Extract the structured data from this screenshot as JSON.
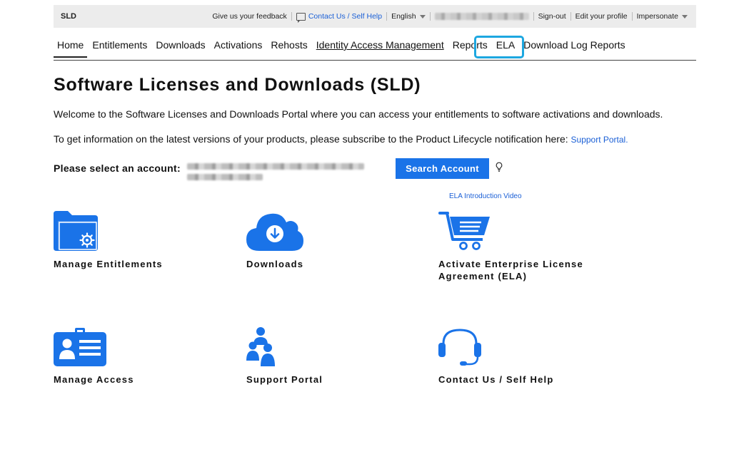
{
  "topbar": {
    "brand": "SLD",
    "feedback": "Give us your feedback",
    "contact": "Contact Us / Self Help",
    "language": "English",
    "signout": "Sign-out",
    "profile": "Edit your profile",
    "impersonate": "Impersonate"
  },
  "nav": {
    "items": [
      "Home",
      "Entitlements",
      "Downloads",
      "Activations",
      "Rehosts",
      "Identity Access Management",
      "Reports",
      "ELA",
      "Download Log Reports"
    ]
  },
  "main": {
    "title": "Software Licenses and Downloads (SLD)",
    "welcome": "Welcome to the Software Licenses and Downloads Portal where you can access your entitlements to software activations and downloads.",
    "subscribe_text": "To get information on the latest versions of your products, please subscribe to the Product Lifecycle notification here: ",
    "subscribe_link": "Support Portal.",
    "account_label": "Please select an account:",
    "search_button": "Search Account",
    "ela_video_link": "ELA Introduction Video"
  },
  "tiles": [
    {
      "label": "Manage Entitlements",
      "icon": "folder-gear-icon"
    },
    {
      "label": "Downloads",
      "icon": "cloud-download-icon"
    },
    {
      "label": "Activate Enterprise License",
      "label2": "Agreement (ELA)",
      "icon": "cart-icon"
    },
    {
      "label": "Manage Access",
      "icon": "id-card-icon"
    },
    {
      "label": "Support Portal",
      "icon": "people-icon"
    },
    {
      "label": "Contact Us / Self Help",
      "icon": "headset-icon"
    }
  ],
  "colors": {
    "accent": "#1a73e8",
    "link": "#1a5fd6",
    "highlight": "#1da7e0"
  }
}
